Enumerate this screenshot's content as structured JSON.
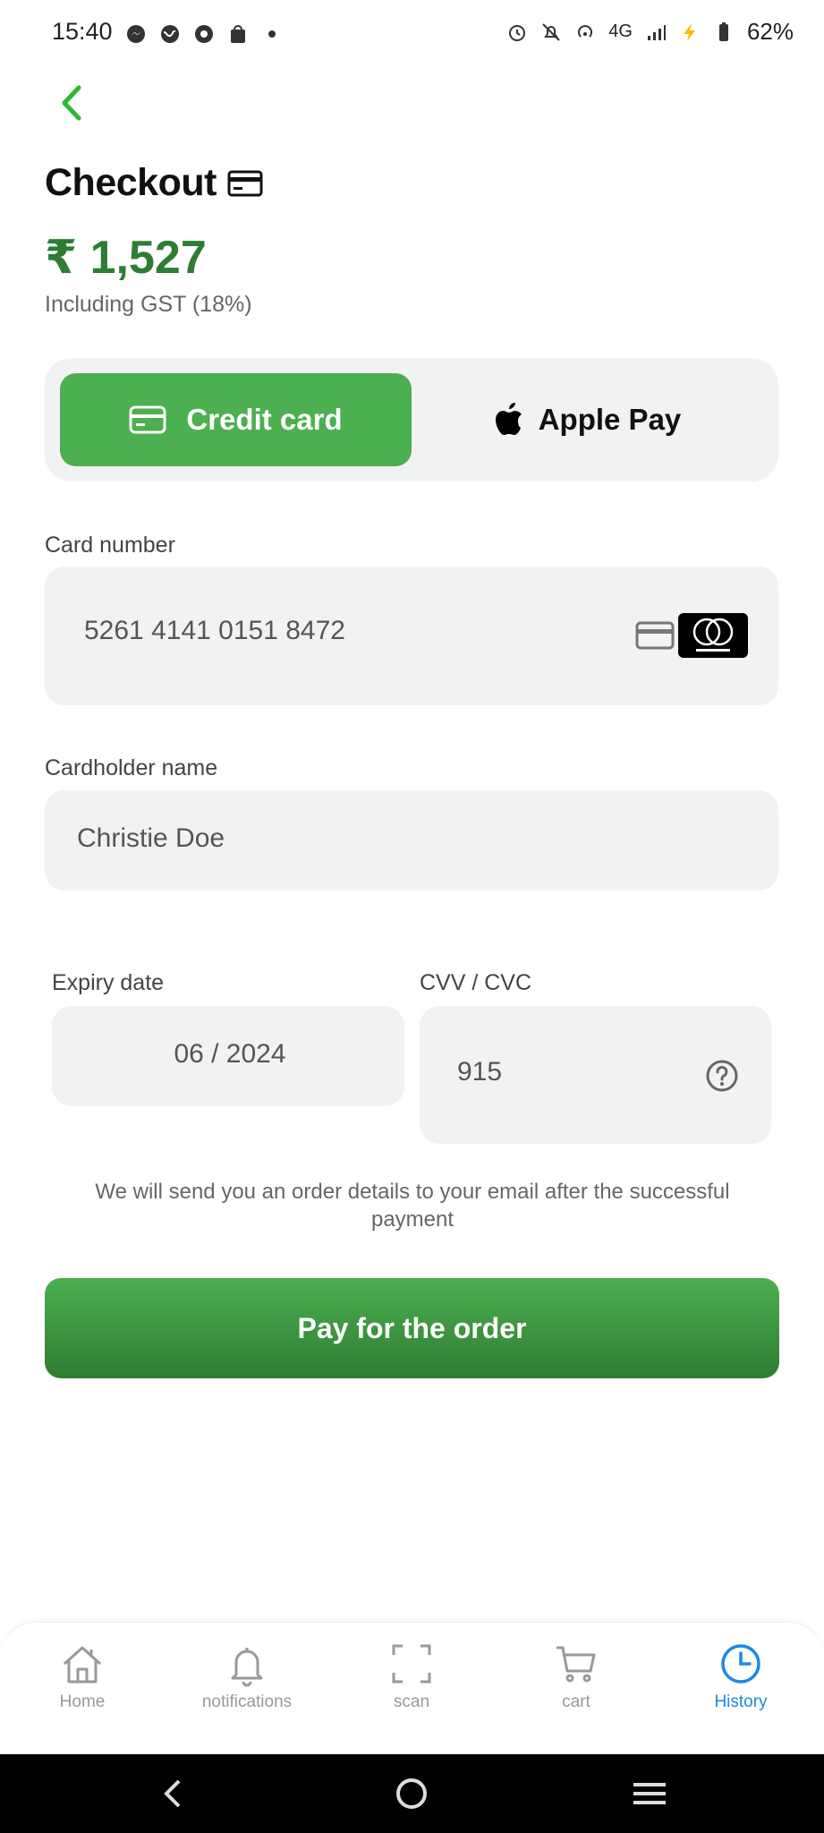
{
  "status": {
    "time": "15:40",
    "network": "4G",
    "battery": "62%"
  },
  "page": {
    "title": "Checkout",
    "total": "₹ 1,527",
    "gst_note": "Including GST (18%)"
  },
  "payment_tabs": [
    {
      "label": "Credit card",
      "icon": "credit-card-icon",
      "selected": true
    },
    {
      "label": "Apple Pay",
      "icon": "apple-icon",
      "selected": false
    }
  ],
  "form": {
    "card_number": {
      "label": "Card number",
      "value": "5261 4141 0151 8472",
      "brand": "mastercard"
    },
    "cardholder": {
      "label": "Cardholder name",
      "value": "Christie Doe"
    },
    "expiry": {
      "label": "Expiry date",
      "value": "06 / 2024"
    },
    "cvv": {
      "label": "CVV / CVC",
      "value": "915"
    }
  },
  "email_note": "We will send you an order details to your email after the successful payment",
  "pay_button": "Pay for the order",
  "bottom_nav": [
    {
      "label": "Home",
      "icon": "home-icon",
      "active": false
    },
    {
      "label": "notifications",
      "icon": "bell-icon",
      "active": false
    },
    {
      "label": "scan",
      "icon": "scan-icon",
      "active": false
    },
    {
      "label": "cart",
      "icon": "cart-icon",
      "active": false
    },
    {
      "label": "History",
      "icon": "history-icon",
      "active": true
    }
  ],
  "colors": {
    "accent": "#4caf50",
    "accent_dark": "#2e7d32",
    "active_nav": "#1e88e5",
    "field_bg": "#f1f2f4"
  }
}
